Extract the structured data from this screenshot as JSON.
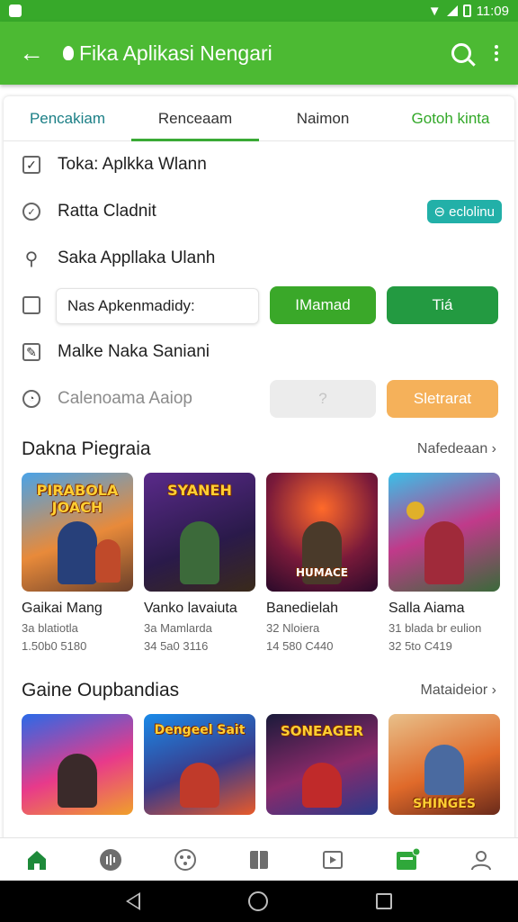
{
  "status_bar": {
    "time": "11:09"
  },
  "app_bar": {
    "title": "Fika Aplikasi Nengari"
  },
  "tabs": [
    "Pencakiam",
    "Renceaam",
    "Naimon",
    "Gotoh kinta"
  ],
  "rows": [
    {
      "label": "Toka: Aplkka Wlann",
      "icon": "checked-box-icon"
    },
    {
      "label": "Ratta Cladnit",
      "icon": "clock-check-icon",
      "badge": "eclolinu"
    },
    {
      "label": "Saka Appllaka Ulanh",
      "icon": "search-icon"
    },
    {
      "label": "Nas Apkenmadidy:",
      "icon": "checkbox-icon",
      "button1": "IMamad",
      "button2": "Tiá"
    },
    {
      "label": "Malke Naka Saniani",
      "icon": "edit-calendar-icon"
    },
    {
      "label": "Calenoama Aaiop",
      "icon": "timer-icon",
      "button_disabled": "?",
      "button_orange": "Sletrarat"
    }
  ],
  "sections": [
    {
      "title": "Dakna Piegraia",
      "more": "Nafedeaan",
      "games": [
        {
          "name": "Gaikai Mang",
          "meta1": "3a blatiotla",
          "meta2": "1.50b0 5180",
          "logo": "PIRABOLA JOACH"
        },
        {
          "name": "Vanko lavaiuta",
          "meta1": "3a Mamlarda",
          "meta2": "34 5a0 3116",
          "logo": "SYANEH"
        },
        {
          "name": "Banedielah",
          "meta1": "32 Nloiera",
          "meta2": "14 580 C440",
          "logo": "HUMACE"
        },
        {
          "name": "Salla Aiama",
          "meta1": "31 blada br eulion",
          "meta2": "32 5to C419",
          "logo": ""
        }
      ]
    },
    {
      "title": "Gaine Oupbandias",
      "more": "Mataideior",
      "games": [
        {
          "logo": ""
        },
        {
          "logo": "Dengeel Sait"
        },
        {
          "logo": "SONEAGER"
        },
        {
          "logo": "SHINGES"
        }
      ]
    }
  ],
  "colors": {
    "primary": "#4cba33",
    "accent_teal": "#22b0a8",
    "orange": "#f5b15a"
  }
}
